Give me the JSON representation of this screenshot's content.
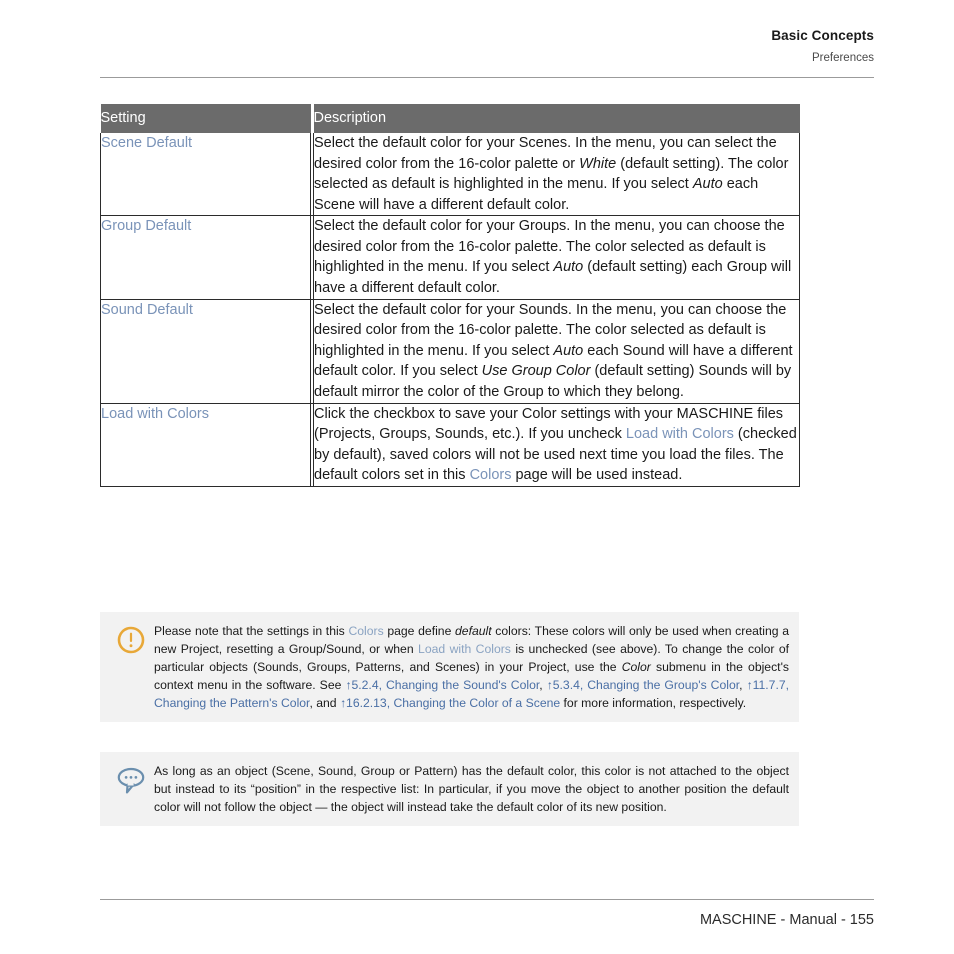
{
  "header": {
    "chapter_title": "Basic Concepts",
    "section_title": "Preferences"
  },
  "table": {
    "columns": [
      "Setting",
      "Description"
    ],
    "rows": [
      {
        "setting": "Scene Default",
        "description_plain": "Select the default color for your Scenes. In the menu, you can select the desired color from the 16-color palette or White (default setting). The color selected as default is highlighted in the menu. If you select Auto each Scene will have a different default color.",
        "segments": [
          {
            "text": "Select the default color for your Scenes. In the menu, you can select the desired color from the 16-color palette or ",
            "style": "normal"
          },
          {
            "text": "White",
            "style": "italic"
          },
          {
            "text": " (default setting). The color selected as default is highlighted in the menu. If you select ",
            "style": "normal"
          },
          {
            "text": "Auto",
            "style": "italic"
          },
          {
            "text": " each Scene will have a different default color.",
            "style": "normal"
          }
        ]
      },
      {
        "setting": "Group Default",
        "description_plain": "Select the default color for your Groups. In the menu, you can choose the desired color from the 16-color palette. The color selected as default is highlighted in the menu. If you select Auto (default setting) each Group will have a different default color.",
        "segments": [
          {
            "text": "Select the default color for your Groups. In the menu, you can choose the desired color from the 16-color palette. The color selected as default is highlighted in the menu. If you select ",
            "style": "normal"
          },
          {
            "text": "Auto",
            "style": "italic"
          },
          {
            "text": " (default setting) each Group will have a different default color.",
            "style": "normal"
          }
        ]
      },
      {
        "setting": "Sound Default",
        "description_plain": "Select the default color for your Sounds. In the menu, you can choose the desired color from the 16-color palette. The color selected as default is highlighted in the menu. If you select Auto each Sound will have a different default color. If you select Use Group Color (default setting) Sounds will by default mirror the color of the Group to which they belong.",
        "segments": [
          {
            "text": "Select the default color for your Sounds. In the menu, you can choose the desired color from the 16-color palette. The color selected as default is highlighted in the menu. If you select ",
            "style": "normal"
          },
          {
            "text": "Auto",
            "style": "italic"
          },
          {
            "text": " each Sound will have a different default color. If you select ",
            "style": "normal"
          },
          {
            "text": "Use Group Color",
            "style": "italic"
          },
          {
            "text": " (default setting) Sounds will by default mirror the color of the Group to which they belong.",
            "style": "normal"
          }
        ]
      },
      {
        "setting": "Load with Colors",
        "description_plain": "Click the checkbox to save your Color settings with your MASCHINE files (Projects, Groups, Sounds, etc.). If you uncheck Load with Colors (checked by default), saved colors will not be used next time you load the files. The default colors set in this Colors page will be used instead.",
        "segments": [
          {
            "text": "Click the checkbox to save your Color settings with your MASCHINE files (Projects, Groups, Sounds, etc.). If you uncheck ",
            "style": "normal"
          },
          {
            "text": "Load with Colors",
            "style": "link"
          },
          {
            "text": " (checked by default), saved colors will not be used next time you load the files. The default colors set in this ",
            "style": "normal"
          },
          {
            "text": "Colors",
            "style": "link"
          },
          {
            "text": " page will be used instead.",
            "style": "normal"
          }
        ]
      }
    ]
  },
  "callouts": [
    {
      "id": "warning",
      "icon": "exclamation-circle-icon",
      "icon_color": "#e8a838",
      "text_plain": "Please note that the settings in this Colors page define default colors: These colors will only be used when creating a new Project, resetting a Group/Sound, or when Load with Colors is unchecked (see above). To change the color of particular objects (Sounds, Groups, Patterns, and Scenes) in your Project, use the Color submenu in the object's context menu in the software. See ↑5.2.4, Changing the Sound's Color, ↑5.3.4, Changing the Group's Color, ↑11.7.7, Changing the Pattern's Color, and ↑16.2.13, Changing the Color of a Scene for more information, respectively.",
      "segments": [
        {
          "text": "Please note that the settings in this ",
          "style": "normal"
        },
        {
          "text": "Colors",
          "style": "link-soft"
        },
        {
          "text": " page define ",
          "style": "normal"
        },
        {
          "text": "default",
          "style": "italic"
        },
        {
          "text": " colors: These colors will only be used when creating a new Project, resetting a Group/Sound, or when ",
          "style": "normal"
        },
        {
          "text": "Load with Colors",
          "style": "link-soft"
        },
        {
          "text": " is unchecked (see above). To change the color of particular objects (Sounds, Groups, Patterns, and Scenes) in your Project, use the ",
          "style": "normal"
        },
        {
          "text": "Color",
          "style": "italic"
        },
        {
          "text": " submenu in the object's context menu in the software. See ",
          "style": "normal"
        },
        {
          "text": "↑5.2.4, Changing the Sound's Color",
          "style": "xref"
        },
        {
          "text": ", ",
          "style": "normal"
        },
        {
          "text": "↑5.3.4, Changing the Group's Color",
          "style": "xref"
        },
        {
          "text": ", ",
          "style": "normal"
        },
        {
          "text": "↑11.7.7, Changing the Pattern's Color",
          "style": "xref"
        },
        {
          "text": ", and ",
          "style": "normal"
        },
        {
          "text": "↑16.2.13, Changing the Color of a Scene",
          "style": "xref"
        },
        {
          "text": " for more information, respectively.",
          "style": "normal"
        }
      ]
    },
    {
      "id": "tip",
      "icon": "speech-bubble-icon",
      "icon_color": "#6b8fae",
      "text_plain": "As long as an object (Scene, Sound, Group or Pattern) has the default color, this color is not attached to the object but instead to its “position” in the respective list: In particular, if you move the object to another position the default color will not follow the object — the object will instead take the default color of its new position.",
      "segments": [
        {
          "text": "As long as an object (Scene, Sound, Group or Pattern) has the default color, this color is not attached to the object but instead to its “position” in the respective list: In particular, if you move the object to another position the default color will not follow the object — the object will instead take the default color of its new position.",
          "style": "normal"
        }
      ]
    }
  ],
  "footer": {
    "text": "MASCHINE - Manual - 155"
  }
}
